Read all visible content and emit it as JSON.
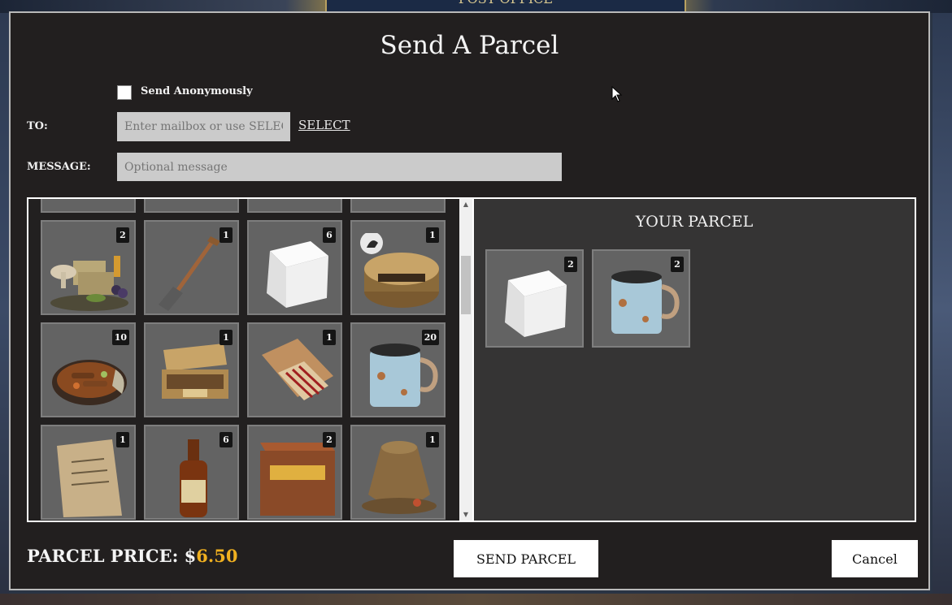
{
  "background": {
    "sign_text": "POST OFFICE"
  },
  "dialog": {
    "title": "Send A Parcel",
    "anonymous_label": "Send Anonymously",
    "anonymous_checked": false,
    "to_label": "TO:",
    "to_placeholder": "Enter mailbox or use SELEC",
    "select_link": "SELECT",
    "message_label": "MESSAGE:",
    "message_placeholder": "Optional message"
  },
  "inventory": {
    "items": [
      {
        "name": "food-bundle",
        "icon": "food-bundle-icon",
        "count": "2"
      },
      {
        "name": "shovel",
        "icon": "shovel-icon",
        "count": "1"
      },
      {
        "name": "sugar-cube",
        "icon": "sugar-cube-icon",
        "count": "6"
      },
      {
        "name": "tobacco-tin",
        "icon": "tobacco-tin-icon",
        "count": "1"
      },
      {
        "name": "stew-plate",
        "icon": "stew-icon",
        "count": "10"
      },
      {
        "name": "cigar-box",
        "icon": "cigar-box-icon",
        "count": "1"
      },
      {
        "name": "matches",
        "icon": "matches-icon",
        "count": "1"
      },
      {
        "name": "tin-mug",
        "icon": "tin-mug-icon",
        "count": "20"
      },
      {
        "name": "document",
        "icon": "document-icon",
        "count": "1"
      },
      {
        "name": "beer-bottle",
        "icon": "beer-bottle-icon",
        "count": "6"
      },
      {
        "name": "crate",
        "icon": "crate-icon",
        "count": "2"
      },
      {
        "name": "grain-sack",
        "icon": "grain-sack-icon",
        "count": "1"
      }
    ]
  },
  "parcel": {
    "title": "YOUR PARCEL",
    "items": [
      {
        "name": "sugar-cube",
        "icon": "sugar-cube-icon",
        "count": "2"
      },
      {
        "name": "tin-mug",
        "icon": "tin-mug-icon",
        "count": "2"
      }
    ]
  },
  "footer": {
    "price_label": "PARCEL PRICE: $",
    "price_value": "6.50",
    "send_button": "SEND PARCEL",
    "cancel_button": "Cancel"
  },
  "colors": {
    "accent_price": "#f0b020",
    "dialog_bg": "#221f1f",
    "slot_bg": "#636363"
  }
}
